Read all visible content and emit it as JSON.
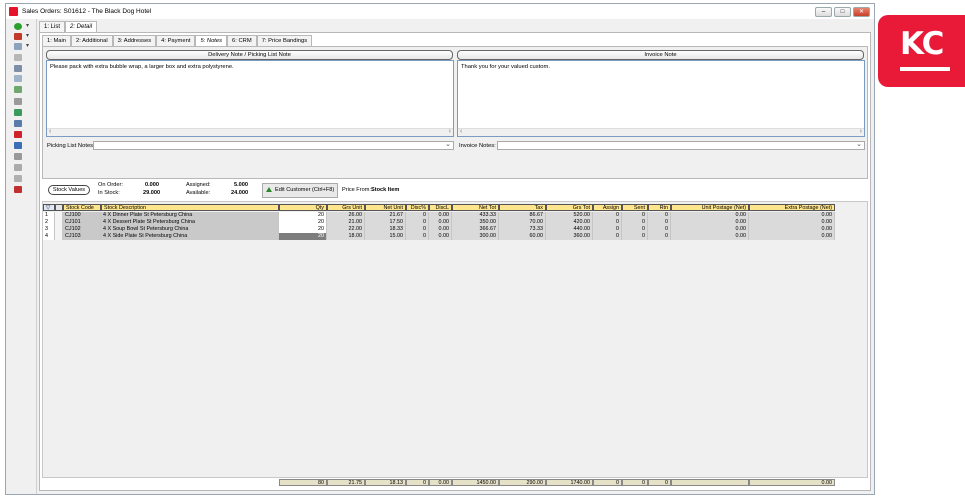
{
  "window": {
    "title": "Sales Orders: S01612 - The Black Dog Hotel",
    "min": "–",
    "max": "□",
    "close": "✕"
  },
  "top_tabs": [
    {
      "label": "1: List"
    },
    {
      "label": "2: Detail"
    }
  ],
  "detail_tabs": [
    "1: Main",
    "2: Additional",
    "3: Addresses",
    "4: Payment",
    "5: Notes",
    "6: CRM",
    "7: Price Bandings"
  ],
  "notes": {
    "delivery_title": "Delivery Note / Picking List Note",
    "delivery_text": "Please pack with extra bubble wrap, a larger box and extra polystyrene.",
    "invoice_title": "Invoice Note",
    "invoice_text": "Thank you for your valued custom.",
    "picking_label": "Picking List Notes:",
    "invoice_label": "Invoice Notes:"
  },
  "stock": {
    "button": "Stock Values",
    "on_order_label": "On Order:",
    "on_order": "0.000",
    "in_stock_label": "In Stock:",
    "in_stock": "29.000",
    "assigned_label": "Assigned:",
    "assigned": "5.000",
    "available_label": "Available:",
    "available": "24.000",
    "edit_customer": "Edit Customer (Ctrl+F8)",
    "price_from_label": "Price From:",
    "price_from": "Stock Item"
  },
  "table": {
    "headers": [
      "Stock Code",
      "Stock Description",
      "Qty",
      "Grs Unit",
      "Net Unit",
      "Disc%",
      "DiscL",
      "Net Tot",
      "Tax",
      "Grs Tot",
      "Assign",
      "Sent",
      "Rtn",
      "Unit Postage (Net)",
      "Extra Postage (Net)"
    ],
    "filter_icon": "filter-icon",
    "rows": [
      {
        "n": "1",
        "code": "CJ100",
        "desc": "4 X Dinner Plate St Petersburg China",
        "qty": "20",
        "grs_unit": "26.00",
        "net_unit": "21.67",
        "disc_pct": "0",
        "discl": "0.00",
        "net_tot": "433.33",
        "tax": "86.67",
        "grs_tot": "520.00",
        "assign": "0",
        "sent": "0",
        "rtn": "0",
        "unit_post": "0.00",
        "extra_post": "0.00"
      },
      {
        "n": "2",
        "code": "CJ101",
        "desc": "4 X Dessert Plate St Petersburg China",
        "qty": "20",
        "grs_unit": "21.00",
        "net_unit": "17.50",
        "disc_pct": "0",
        "discl": "0.00",
        "net_tot": "350.00",
        "tax": "70.00",
        "grs_tot": "420.00",
        "assign": "0",
        "sent": "0",
        "rtn": "0",
        "unit_post": "0.00",
        "extra_post": "0.00"
      },
      {
        "n": "3",
        "code": "CJ102",
        "desc": "4 X Soup Bowl St Petersburg China",
        "qty": "20",
        "grs_unit": "22.00",
        "net_unit": "18.33",
        "disc_pct": "0",
        "discl": "0.00",
        "net_tot": "366.67",
        "tax": "73.33",
        "grs_tot": "440.00",
        "assign": "0",
        "sent": "0",
        "rtn": "0",
        "unit_post": "0.00",
        "extra_post": "0.00"
      },
      {
        "n": "4",
        "code": "CJ103",
        "desc": "4 X Side Plate St Petersburg China",
        "qty": "20",
        "grs_unit": "18.00",
        "net_unit": "15.00",
        "disc_pct": "0",
        "discl": "0.00",
        "net_tot": "300.00",
        "tax": "60.00",
        "grs_tot": "360.00",
        "assign": "0",
        "sent": "0",
        "rtn": "0",
        "unit_post": "0.00",
        "extra_post": "0.00"
      }
    ],
    "totals": {
      "qty": "80",
      "grs_unit": "21.75",
      "net_unit": "18.13",
      "disc_pct": "0",
      "discl": "0.00",
      "net_tot": "1450.00",
      "tax": "290.00",
      "grs_tot": "1740.00",
      "assign": "0",
      "sent": "0",
      "rtn": "0",
      "extra_post": "0.00"
    }
  },
  "logo": {
    "text": "KC",
    "color": "#e81a38"
  }
}
